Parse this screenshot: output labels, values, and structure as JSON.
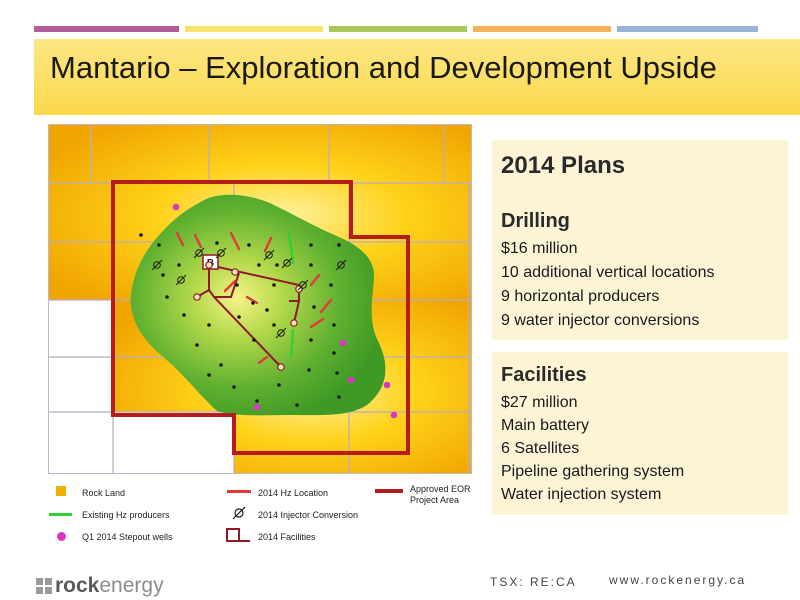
{
  "colors": {
    "stripes": [
      "#b35c9a",
      "#f6e46e",
      "#a9c85a",
      "#f6b15a",
      "#9ab2d7"
    ],
    "title_band": "#fbd94c",
    "land": "#f2b000",
    "pool": "#4ea32b",
    "project_outline": "#b71c1c",
    "hz_location": "#e23a3a",
    "existing_hz": "#30d230",
    "stepout": "#d936c2",
    "panel_bg": "#fdf4d6"
  },
  "title": "Mantario – Exploration and Development Upside",
  "plans": {
    "heading": "2014 Plans",
    "drilling": {
      "heading": "Drilling",
      "lines": [
        "$16 million",
        "10 additional vertical locations",
        "9 horizontal producers",
        "9 water injector conversions"
      ]
    },
    "facilities": {
      "heading": "Facilities",
      "lines": [
        "$27 million",
        "Main battery",
        "6 Satellites",
        "Pipeline gathering system",
        "Water injection system"
      ]
    }
  },
  "map": {
    "battery_label": "B"
  },
  "legend": {
    "rock_land": "Rock Land",
    "existing_hz": "Existing Hz producers",
    "stepout": "Q1 2014 Stepout wells",
    "hz_location": "2014 Hz Location",
    "injector": "2014 Injector Conversion",
    "facilities": "2014 Facilities",
    "eor_line1": "Approved EOR",
    "eor_line2": "Project Area"
  },
  "footer": {
    "logo_prefix": "rock",
    "logo_suffix": "energy",
    "ticker": "TSX: RE:CA",
    "url": "www.rockenergy.ca"
  }
}
